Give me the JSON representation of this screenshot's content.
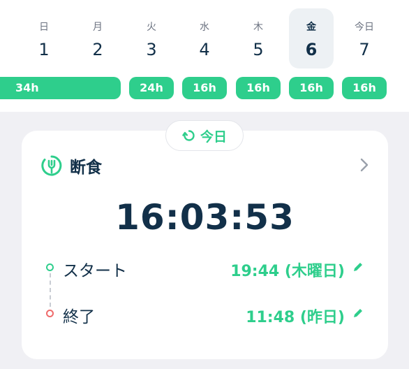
{
  "week": {
    "days": [
      {
        "dow": "日",
        "num": "1",
        "hours": "34h"
      },
      {
        "dow": "月",
        "num": "2",
        "hours": "24h"
      },
      {
        "dow": "火",
        "num": "3",
        "hours": "16h"
      },
      {
        "dow": "水",
        "num": "4",
        "hours": "16h"
      },
      {
        "dow": "木",
        "num": "5",
        "hours": "16h"
      },
      {
        "dow": "金",
        "num": "6",
        "hours": "16h"
      },
      {
        "dow": "今日",
        "num": "7",
        "hours": "16h"
      }
    ],
    "selected_day": "6"
  },
  "today_chip": {
    "label": "今日"
  },
  "card": {
    "title": "断食",
    "timer": "16:03:53",
    "start": {
      "label": "スタート",
      "value": "19:44 (木曜日)"
    },
    "end": {
      "label": "終了",
      "value": "11:48 (昨日)"
    }
  },
  "colors": {
    "accent": "#2ece8c",
    "text": "#123049",
    "end_dot": "#ef6b6b",
    "background": "#f0f0f4"
  },
  "icons": {
    "fasting": "fork-clock-icon",
    "today": "rotate-icon",
    "chevron": "chevron-right-icon",
    "edit": "pencil-icon"
  }
}
